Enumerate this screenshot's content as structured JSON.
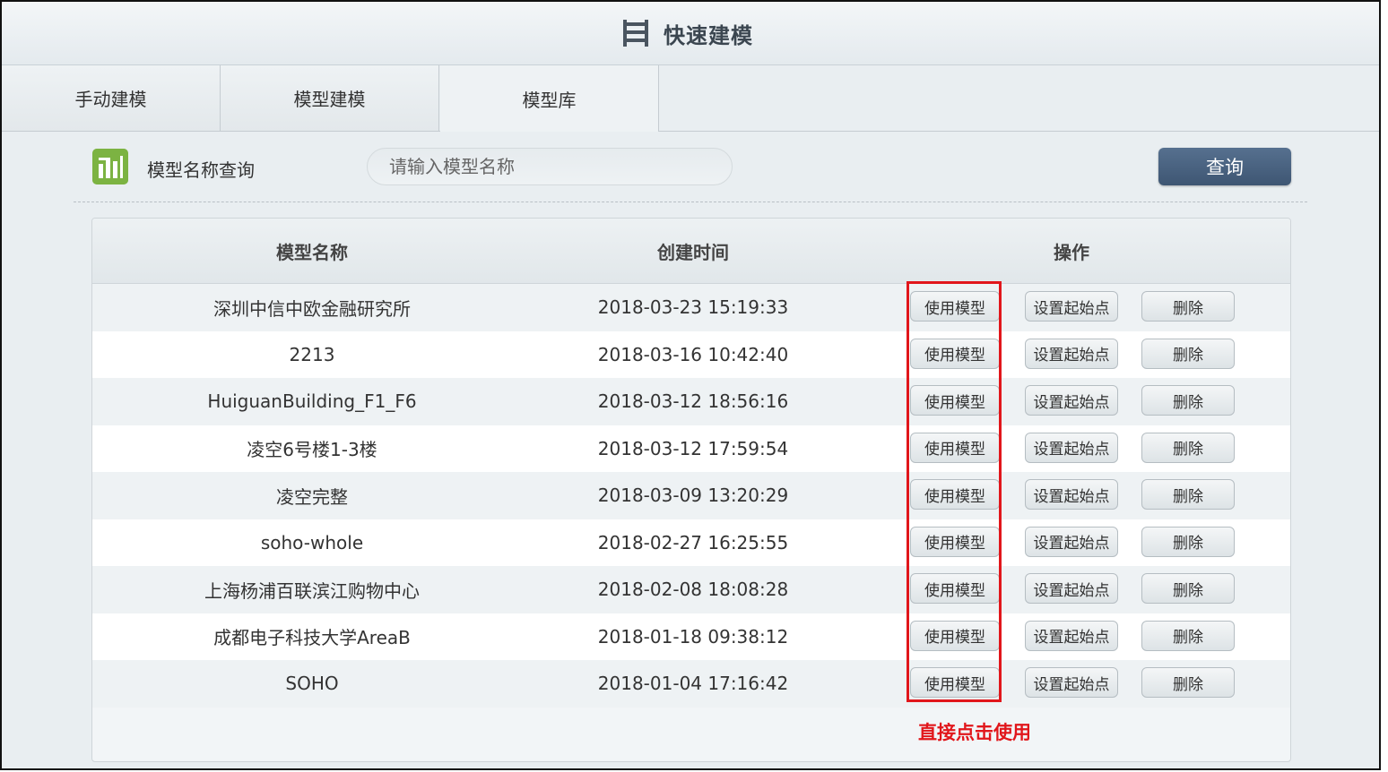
{
  "window": {
    "title": "快速建模",
    "icon": "building-floors-icon"
  },
  "tabs": [
    {
      "label": "手动建模",
      "active": false
    },
    {
      "label": "模型建模",
      "active": false
    },
    {
      "label": "模型库",
      "active": true
    }
  ],
  "search": {
    "icon": "bar-chart-icon",
    "label": "模型名称查询",
    "placeholder": "请输入模型名称",
    "button": "查询"
  },
  "table": {
    "headers": {
      "name": "模型名称",
      "time": "创建时间",
      "actions": "操作"
    },
    "action_labels": {
      "use": "使用模型",
      "start": "设置起始点",
      "delete": "删除"
    },
    "rows": [
      {
        "name": "深圳中信中欧金融研究所",
        "time": "2018-03-23 15:19:33"
      },
      {
        "name": "2213",
        "time": "2018-03-16 10:42:40"
      },
      {
        "name": "HuiguanBuilding_F1_F6",
        "time": "2018-03-12 18:56:16"
      },
      {
        "name": "凌空6号楼1-3楼",
        "time": "2018-03-12 17:59:54"
      },
      {
        "name": "凌空完整",
        "time": "2018-03-09 13:20:29"
      },
      {
        "name": "soho-whole",
        "time": "2018-02-27 16:25:55"
      },
      {
        "name": "上海杨浦百联滨江购物中心",
        "time": "2018-02-08 18:08:28"
      },
      {
        "name": "成都电子科技大学AreaB",
        "time": "2018-01-18 09:38:12"
      },
      {
        "name": "SOHO",
        "time": "2018-01-04 17:16:42"
      }
    ]
  },
  "annotation": {
    "text": "直接点击使用",
    "color": "#e1161b"
  },
  "colors": {
    "query_button": "#3e5673",
    "search_icon": "#7cb342",
    "highlight": "#e1161b"
  }
}
